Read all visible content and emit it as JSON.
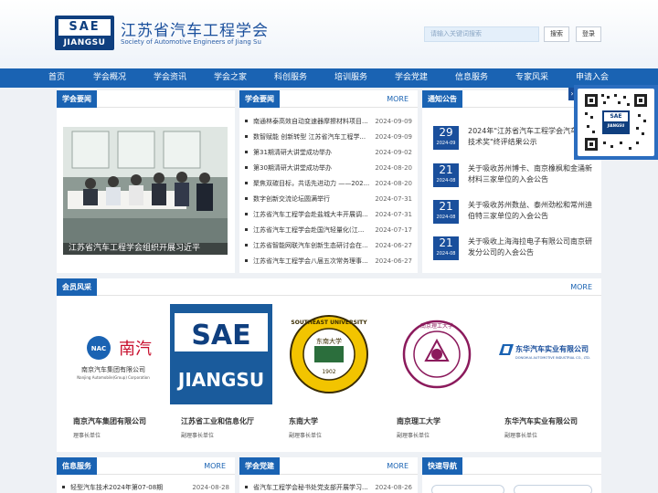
{
  "header": {
    "logo_top": "SAE",
    "logo_bottom": "JIANGSU",
    "title": "江苏省汽车工程学会",
    "subtitle": "Society of Automotive Engineers of Jiang Su",
    "search_placeholder": "请输入关键词搜索",
    "search_button": "搜索",
    "login_button": "登录"
  },
  "nav": [
    "首页",
    "学会概况",
    "学会资讯",
    "学会之家",
    "科创服务",
    "培训服务",
    "学会党建",
    "信息服务",
    "专家风采",
    "申请入会"
  ],
  "featured": {
    "header": "学会要闻",
    "caption": "江苏省汽车工程学会组织开展习近平"
  },
  "news": {
    "header": "学会要闻",
    "more": "MORE",
    "items": [
      {
        "title": "南通林泰高效自动变速器摩擦材料项目...",
        "date": "2024-09-09"
      },
      {
        "title": "数智赋能 创新转型 江苏省汽车工程学...",
        "date": "2024-09-09"
      },
      {
        "title": "第31期清研大讲堂成功举办",
        "date": "2024-09-02"
      },
      {
        "title": "第30期清研大讲堂成功举办",
        "date": "2024-08-20"
      },
      {
        "title": "聚焦双碳目标，共话先进动力 ——202...",
        "date": "2024-08-20"
      },
      {
        "title": "数字创新交流论坛圆满举行",
        "date": "2024-07-31"
      },
      {
        "title": "江苏省汽车工程学会赴盐城大丰开展调...",
        "date": "2024-07-31"
      },
      {
        "title": "江苏省汽车工程学会赴国汽轻量化(江...",
        "date": "2024-07-17"
      },
      {
        "title": "江苏省智能网联汽车创新生态研讨会在...",
        "date": "2024-06-27"
      },
      {
        "title": "江苏省汽车工程学会八届五次常务理事...",
        "date": "2024-06-27"
      }
    ]
  },
  "notices": {
    "header": "通知公告",
    "items": [
      {
        "day": "29",
        "ym": "2024-09",
        "text": "2024年\"江苏省汽车工程学会汽车科学技术奖\"终评结果公示"
      },
      {
        "day": "21",
        "ym": "2024-08",
        "text": "关于吸收苏州博卡、南京橡枫和金涌新材料三家单位的入会公告"
      },
      {
        "day": "21",
        "ym": "2024-08",
        "text": "关于吸收苏州数益、泰州劲松和常州迪伯特三家单位的入会公告"
      },
      {
        "day": "21",
        "ym": "2024-08",
        "text": "关于吸收上海海拉电子有限公司南京研发分公司的入会公告"
      }
    ]
  },
  "members": {
    "header": "会员风采",
    "more": "MORE",
    "items": [
      {
        "name": "南京汽车集团有限公司",
        "role": "理事长单位",
        "logo_text_cn": "南汽",
        "logo_badge": "NAC",
        "logo_line1": "南京汽车集团有限公司",
        "logo_line2": "Nanjing Automobile(Group) Corporation"
      },
      {
        "name": "江苏省工业和信息化厅",
        "role": "副理事长单位",
        "logo_top": "SAE",
        "logo_bottom": "JIANGSU"
      },
      {
        "name": "东南大学",
        "role": "副理事长单位",
        "logo_ring": "SOUTHEAST UNIVERSITY",
        "logo_center": "东南大学",
        "logo_year": "1902"
      },
      {
        "name": "南京理工大学",
        "role": "副理事长单位",
        "logo_ring": "南京理工大学"
      },
      {
        "name": "东华汽车实业有限公司",
        "role": "副理事长单位",
        "logo_cn": "东华汽车实业有限公司",
        "logo_en": "DONGHUA AUTOMOTIVE INDUSTRIAL CO., LTD."
      }
    ]
  },
  "bottom": {
    "info_header": "信息服务",
    "info_more": "MORE",
    "info_item_title": "轻型汽车技术2024年第07-08期",
    "info_item_date": "2024-08-28",
    "party_header": "学会党建",
    "party_more": "MORE",
    "party_item_title": "省汽车工程学会秘书处党支部开展学习...",
    "party_item_date": "2024-08-26",
    "quick_header": "快速导航"
  },
  "qr": {
    "logo_top": "SAE",
    "logo_bottom": "JIANGSU"
  },
  "colors": {
    "primary": "#1a63b3",
    "dark_blue": "#1a4f9c",
    "background": "#eef1f5"
  }
}
